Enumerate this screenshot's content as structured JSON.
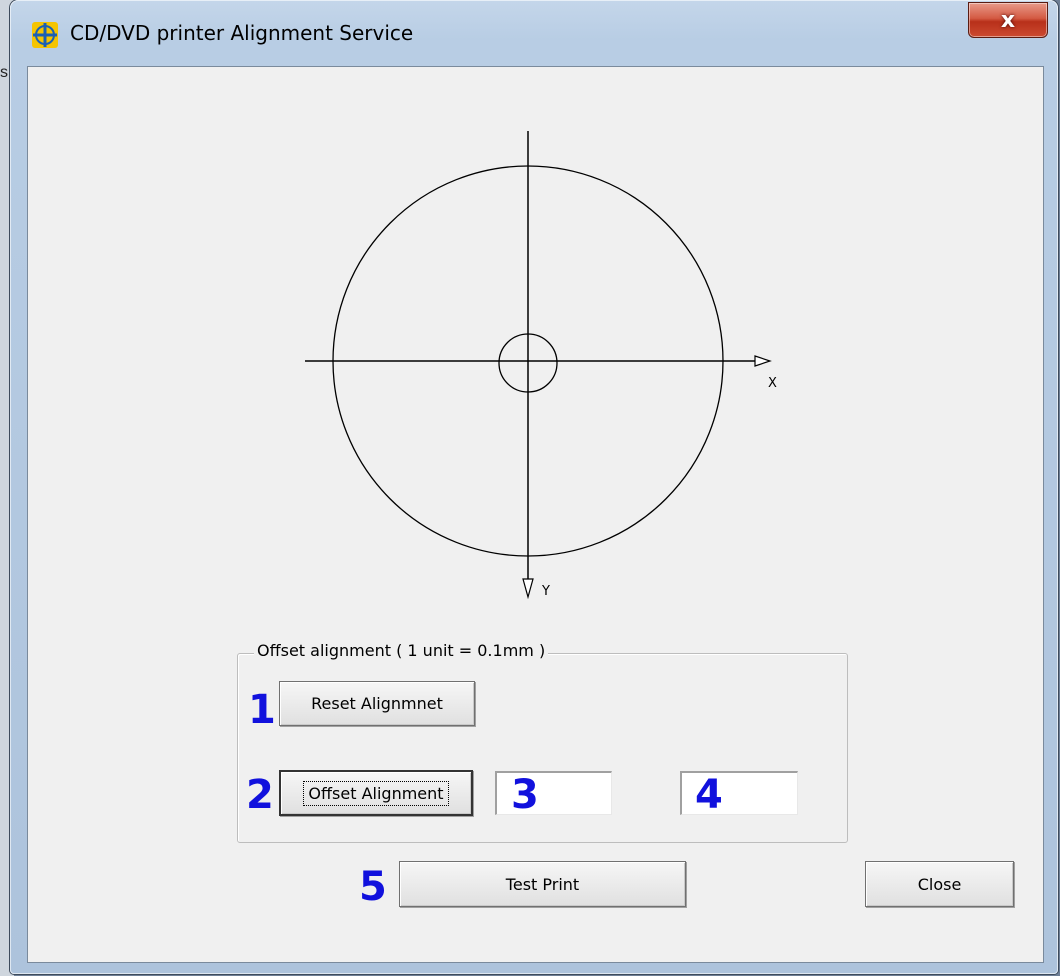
{
  "window": {
    "title": "CD/DVD printer Alignment Service",
    "close_glyph": "x",
    "background_letter": "s"
  },
  "diagram": {
    "x_axis_label": "X",
    "y_axis_label": "Y"
  },
  "offset_group": {
    "label": "Offset alignment ( 1 unit = 0.1mm )",
    "reset_button_label": "Reset Alignmnet",
    "offset_button_label": "Offset Alignment",
    "x_offset_value": "",
    "y_offset_value": ""
  },
  "footer": {
    "test_print_label": "Test Print",
    "close_label": "Close"
  },
  "annotations": [
    "1",
    "2",
    "3",
    "4",
    "5"
  ],
  "icons": {
    "app": "alignment-cross-icon",
    "close": "close-icon"
  },
  "colors": {
    "annotation": "#1111dd",
    "close_button": "#c8412a",
    "dialog_background": "#f0f0f0"
  }
}
